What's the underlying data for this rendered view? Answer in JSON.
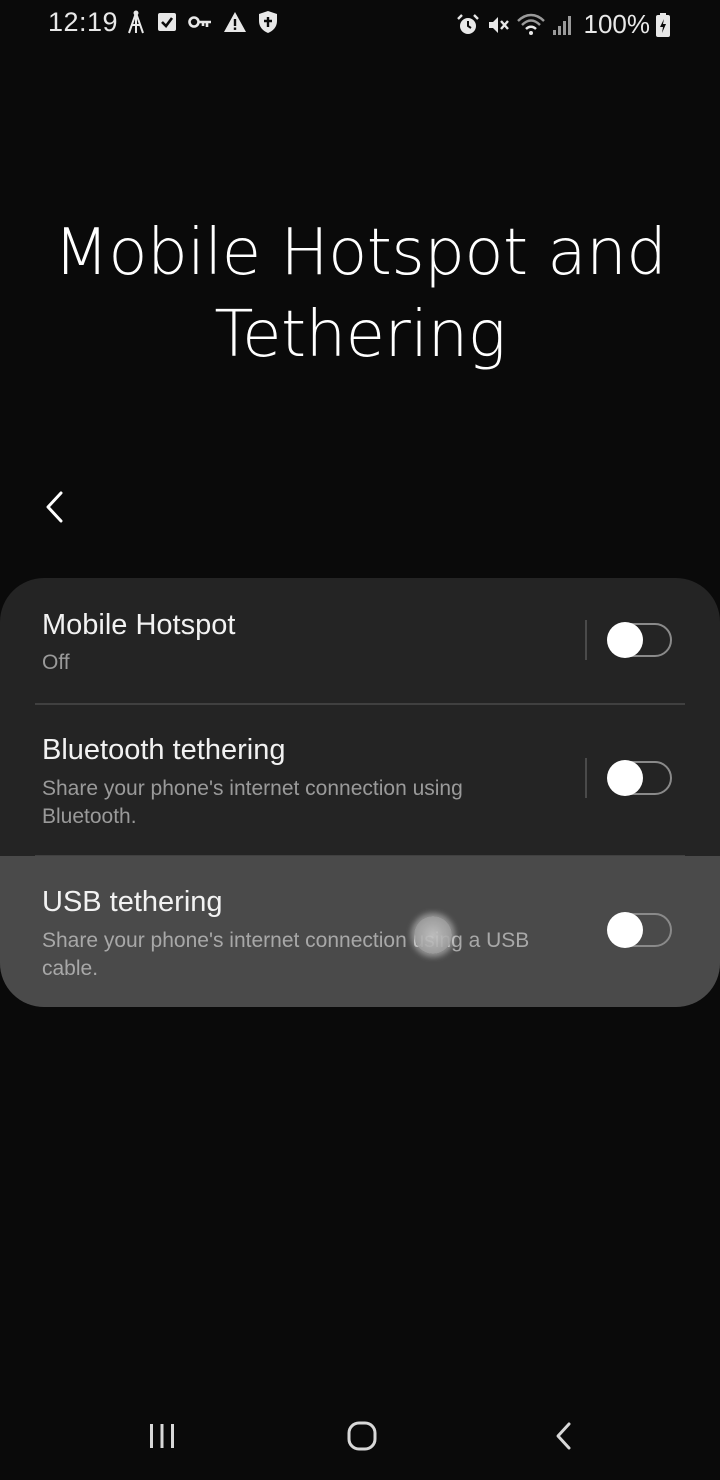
{
  "status_bar": {
    "time": "12:19",
    "left_icons": [
      "cell-tower-icon",
      "checkbox-icon",
      "key-icon",
      "warning-icon",
      "shield-icon"
    ],
    "right_icons": [
      "alarm-icon",
      "mute-icon",
      "wifi-icon",
      "signal-icon",
      "battery-charging-icon"
    ],
    "battery": "100%"
  },
  "page": {
    "title": "Mobile Hotspot and Tethering",
    "back_icon": "chevron-left-icon"
  },
  "settings": {
    "items": [
      {
        "title": "Mobile Hotspot",
        "summary": "Off",
        "enabled": false
      },
      {
        "title": "Bluetooth tethering",
        "summary": "Share your phone's internet connection using Bluetooth.",
        "enabled": false
      },
      {
        "title": "USB tethering",
        "summary": "Share your phone's internet connection using a USB cable.",
        "enabled": false
      }
    ]
  },
  "nav_bar": {
    "buttons": [
      "recents-icon",
      "home-icon",
      "back-icon"
    ]
  },
  "colors": {
    "background": "#0a0a0a",
    "card": "#242424",
    "pressed_row": "#4a4a4a",
    "summary_text": "#9a9a9a"
  }
}
